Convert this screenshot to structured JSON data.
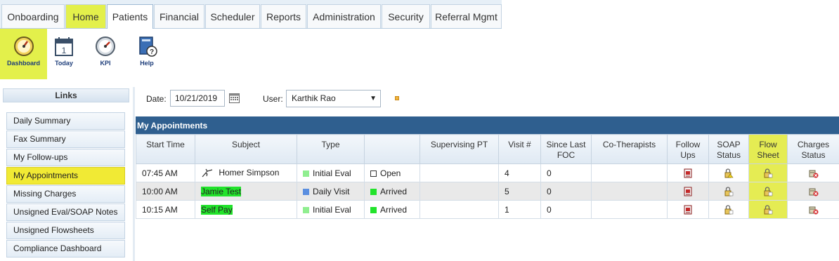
{
  "tabs": [
    "Onboarding",
    "Home",
    "Patients",
    "Financial",
    "Scheduler",
    "Reports",
    "Administration",
    "Security",
    "Referral Mgmt"
  ],
  "ribbon": {
    "items": [
      {
        "label": "Dashboard",
        "icon": "gauge-icon"
      },
      {
        "label": "Today",
        "icon": "calendar-icon"
      },
      {
        "label": "KPI",
        "icon": "gauge-icon"
      },
      {
        "label": "Help",
        "icon": "help-book-icon"
      }
    ]
  },
  "links": {
    "title": "Links",
    "items": [
      "Daily Summary",
      "Fax Summary",
      "My Follow-ups",
      "My Appointments",
      "Missing Charges",
      "Unsigned Eval/SOAP Notes",
      "Unsigned Flowsheets",
      "Compliance Dashboard"
    ],
    "selected": "My Appointments"
  },
  "filter": {
    "date_label": "Date:",
    "date_value": "10/21/2019",
    "user_label": "User:",
    "user_value": "Karthik Rao"
  },
  "appointments": {
    "title": "My Appointments",
    "columns": [
      "Start Time",
      "Subject",
      "Type",
      "",
      "Supervising PT",
      "Visit #",
      "Since Last FOC",
      "Co-Therapists",
      "Follow Ups",
      "SOAP Status",
      "Flow Sheet",
      "Charges Status"
    ],
    "rows": [
      {
        "time": "07:45 AM",
        "subject": "Homer Simpson",
        "type": "Initial Eval",
        "status": "Open",
        "supervising": "",
        "visit": "4",
        "since_foc": "0",
        "cotherapists": ""
      },
      {
        "time": "10:00 AM",
        "subject": "Jamie Test",
        "type": "Daily Visit",
        "status": "Arrived",
        "supervising": "",
        "visit": "5",
        "since_foc": "0",
        "cotherapists": ""
      },
      {
        "time": "10:15 AM",
        "subject": "Self Pay",
        "type": "Initial Eval",
        "status": "Arrived",
        "supervising": "",
        "visit": "1",
        "since_foc": "0",
        "cotherapists": ""
      }
    ]
  },
  "colors": {
    "highlight_yellow": "#e3f04b",
    "grid_header": "#2f5f8f",
    "arrived_green": "#22e32b",
    "initial_eval": "#90ee90",
    "daily_visit": "#5b8fe0"
  }
}
